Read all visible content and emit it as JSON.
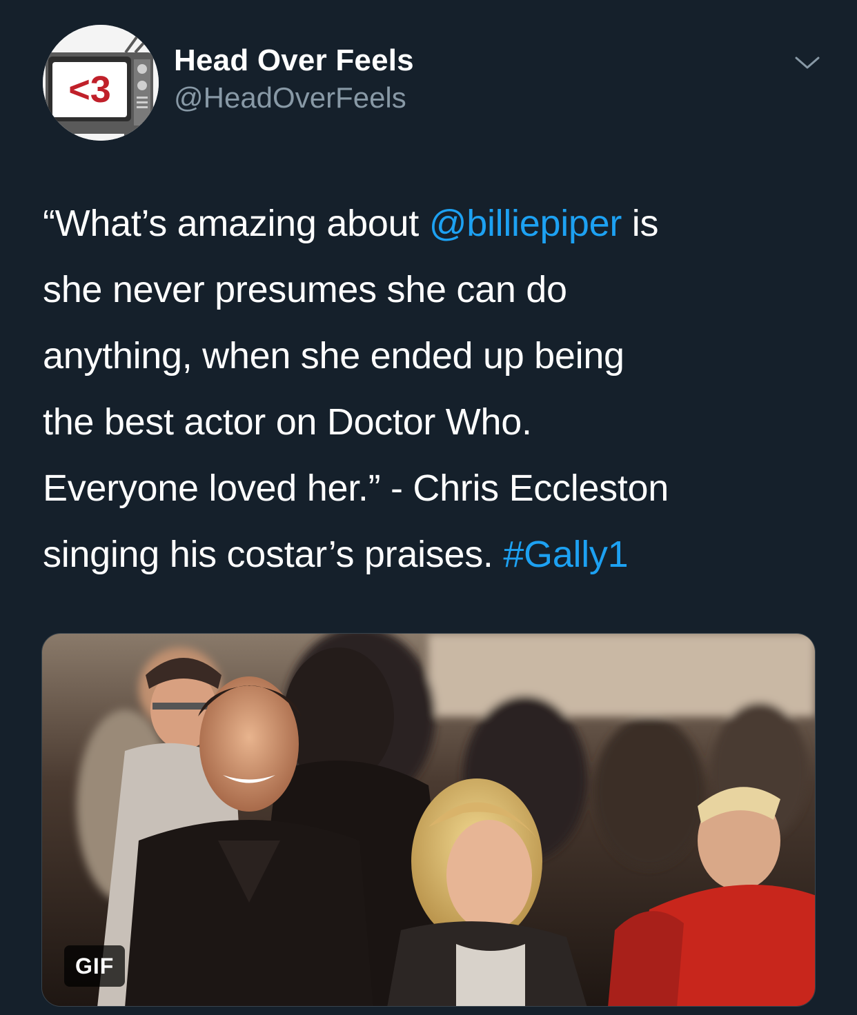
{
  "header": {
    "display_name": "Head Over Feels",
    "handle": "@HeadOverFeels",
    "avatar_text": "<3"
  },
  "tweet": {
    "lines": [
      {
        "parts": [
          {
            "text": "“What’s amazing about ",
            "link": false
          },
          {
            "text": "@billiepiper",
            "link": true
          },
          {
            "text": " is",
            "link": false
          }
        ]
      },
      {
        "parts": [
          {
            "text": "she never presumes she can do",
            "link": false
          }
        ]
      },
      {
        "parts": [
          {
            "text": "anything, when she ended up being",
            "link": false
          }
        ]
      },
      {
        "parts": [
          {
            "text": "the best actor on Doctor Who.",
            "link": false
          }
        ]
      },
      {
        "parts": [
          {
            "text": "Everyone loved her.” - Chris Eccleston",
            "link": false
          }
        ]
      },
      {
        "parts": [
          {
            "text": "singing his costar’s praises. ",
            "link": false
          },
          {
            "text": "#Gally1",
            "link": true
          }
        ]
      }
    ]
  },
  "media": {
    "badge": "GIF"
  },
  "colors": {
    "background": "#15202b",
    "link": "#1da1f2",
    "secondary_text": "#8899a6",
    "primary_text": "#ffffff"
  },
  "icons": {
    "menu": "chevron-down-icon"
  }
}
